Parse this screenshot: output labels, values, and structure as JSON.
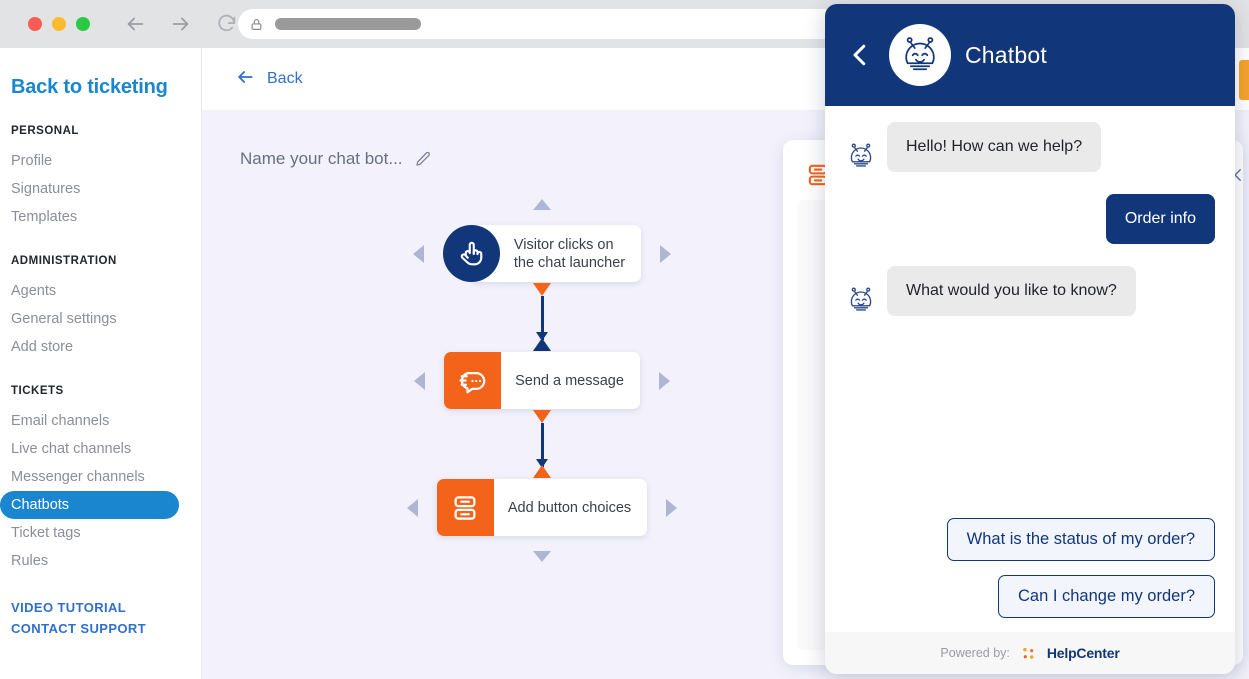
{
  "browser": {
    "traffic_lights": [
      "close",
      "minimize",
      "maximize"
    ],
    "back_icon": "arrow-left-icon",
    "forward_icon": "arrow-right-icon",
    "reload_icon": "reload-icon",
    "lock_icon": "lock-icon",
    "url_value": ""
  },
  "sidebar": {
    "back_link": "Back to ticketing",
    "groups": [
      {
        "heading": "PERSONAL",
        "items": [
          {
            "label": "Profile",
            "active": false
          },
          {
            "label": "Signatures",
            "active": false
          },
          {
            "label": "Templates",
            "active": false
          }
        ]
      },
      {
        "heading": "ADMINISTRATION",
        "items": [
          {
            "label": "Agents",
            "active": false
          },
          {
            "label": "General settings",
            "active": false
          },
          {
            "label": "Add store",
            "active": false
          }
        ]
      },
      {
        "heading": "TICKETS",
        "items": [
          {
            "label": "Email channels",
            "active": false
          },
          {
            "label": "Live chat channels",
            "active": false
          },
          {
            "label": "Messenger channels",
            "active": false
          },
          {
            "label": "Chatbots",
            "active": true
          },
          {
            "label": "Ticket tags",
            "active": false
          },
          {
            "label": "Rules",
            "active": false
          }
        ]
      }
    ],
    "footer_links": [
      "VIDEO TUTORIAL",
      "CONTACT SUPPORT"
    ]
  },
  "main": {
    "back_label": "Back",
    "back_icon": "arrow-left-icon",
    "bot_name_placeholder": "Name your chat bot...",
    "edit_icon": "pencil-icon",
    "nodes": [
      {
        "label": "Visitor clicks on\nthe chat launcher",
        "icon": "pointing-hand-icon",
        "shape": "circle",
        "color": "#12367a"
      },
      {
        "label": "Send a message",
        "icon": "chat-message-icon",
        "shape": "square",
        "color": "#f3641a"
      },
      {
        "label": "Add button choices",
        "icon": "button-choices-icon",
        "shape": "square",
        "color": "#f3641a"
      }
    ]
  },
  "preview": {
    "panel_icon": "button-choices-icon",
    "bot_icon": "robot-icon",
    "close_icon": "close-icon"
  },
  "widget": {
    "title": "Chatbot",
    "back_icon": "chevron-left-icon",
    "avatar_icon": "robot-avatar-icon",
    "messages": [
      {
        "from": "bot",
        "text": "Hello! How can we help?",
        "avatar_icon": "robot-icon"
      },
      {
        "from": "user",
        "text": "Order info"
      },
      {
        "from": "bot",
        "text": "What would you like to know?",
        "avatar_icon": "robot-icon"
      }
    ],
    "quick_replies": [
      "What is the status of my order?",
      "Can I change my order?"
    ],
    "footer": {
      "powered_label": "Powered by:",
      "brand": "HelpCenter",
      "brand_icon": "helpcenter-logo-icon"
    }
  },
  "colors": {
    "navy": "#12367a",
    "orange": "#f3641a",
    "accent_blue": "#1b86d0",
    "link_blue": "#2f6fce",
    "canvas": "#f3f2fc"
  }
}
